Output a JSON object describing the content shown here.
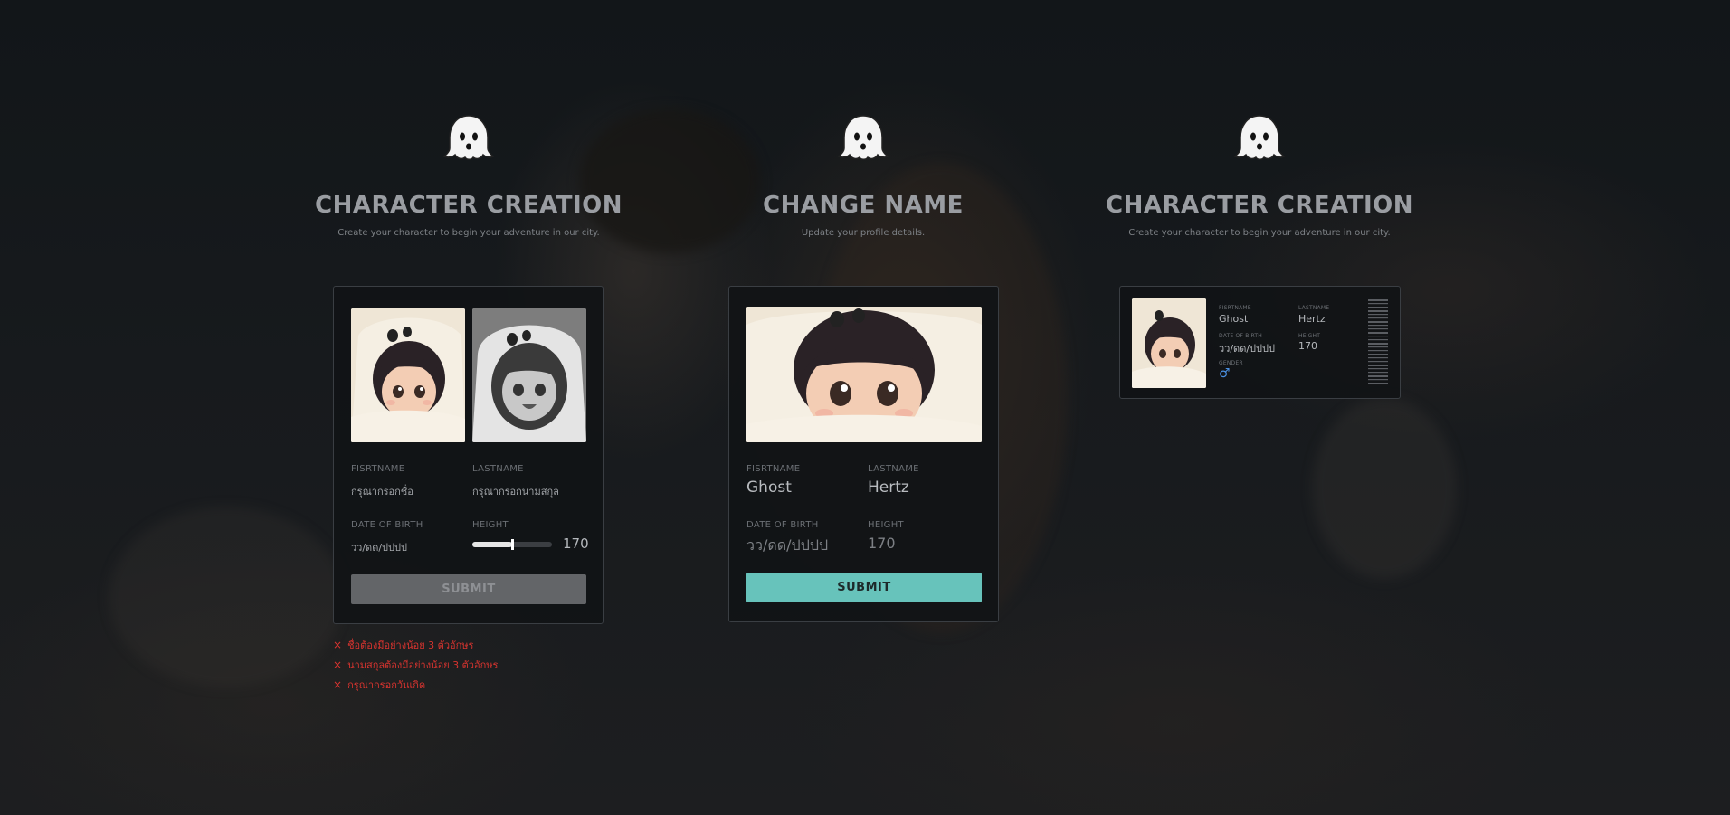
{
  "theme": {
    "accent": "#67c3bb",
    "error": "#d8342f",
    "disabled_button": "#6b6d70"
  },
  "panels": {
    "creation": {
      "icon": "ghost-icon",
      "title": "CHARACTER CREATION",
      "subtitle": "Create your character to begin your adventure in our city.",
      "firstname_label": "FISRTNAME",
      "firstname_placeholder": "กรุณากรอกชื่อ",
      "lastname_label": "LASTNAME",
      "lastname_placeholder": "กรุณากรอกนามสกุล",
      "dob_label": "DATE OF BIRTH",
      "dob_placeholder": "วว/ดด/ปปปป",
      "height_label": "HEIGHT",
      "height_value": "170",
      "height_slider_fraction": 0.5,
      "submit_label": "SUBMIT",
      "errors": [
        "ชื่อต้องมีอย่างน้อย 3 ตัวอักษร",
        "นามสกุลต้องมีอย่างน้อย 3 ตัวอักษร",
        "กรุณากรอกวันเกิด"
      ]
    },
    "change_name": {
      "icon": "ghost-icon",
      "title": "CHANGE NAME",
      "subtitle": "Update your profile details.",
      "firstname_label": "FISRTNAME",
      "firstname_value": "Ghost",
      "lastname_label": "LASTNAME",
      "lastname_value": "Hertz",
      "dob_label": "DATE OF BIRTH",
      "dob_value": "วว/ดด/ปปปป",
      "height_label": "HEIGHT",
      "height_value": "170",
      "submit_label": "SUBMIT"
    },
    "id_card": {
      "icon": "ghost-icon",
      "title": "CHARACTER CREATION",
      "subtitle": "Create your character to begin your adventure in our city.",
      "firstname_label": "FISRTNAME",
      "firstname_value": "Ghost",
      "lastname_label": "LASTNAME",
      "lastname_value": "Hertz",
      "dob_label": "DATE OF BIRTH",
      "dob_value": "วว/ดด/ปปปป",
      "height_label": "HEIGHT",
      "height_value": "170",
      "gender_label": "GENDER",
      "gender_symbol": "♂",
      "gender_icon": "male-symbol-icon"
    }
  }
}
